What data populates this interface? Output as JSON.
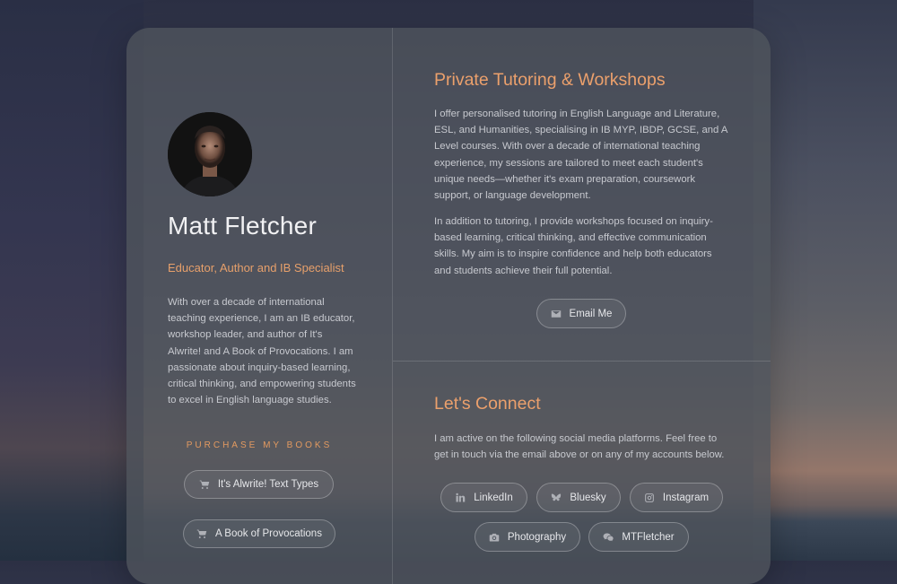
{
  "profile": {
    "name": "Matt Fletcher",
    "subtitle": "Educator, Author and IB Specialist",
    "bio": "With over a decade of international teaching experience, I am an IB educator, workshop leader, and author of It's Alwrite! and A Book of Provocations. I am passionate about inquiry-based learning, critical thinking, and empowering students to excel in English language studies."
  },
  "books": {
    "title": "PURCHASE MY BOOKS",
    "items": [
      {
        "label": "It's Alwrite! Text Types",
        "icon": "cart-icon"
      },
      {
        "label": "A Book of Provocations",
        "icon": "cart-icon"
      }
    ]
  },
  "tutoring": {
    "title": "Private Tutoring & Workshops",
    "para1": "I offer personalised tutoring in English Language and Literature, ESL, and Humanities, specialising in IB MYP, IBDP, GCSE, and A Level courses. With over a decade of international teaching experience, my sessions are tailored to meet each student's unique needs—whether it's exam preparation, coursework support, or language development.",
    "para2": "In addition to tutoring, I provide workshops focused on inquiry-based learning, critical thinking, and effective communication skills. My aim is to inspire confidence and help both educators and students achieve their full potential.",
    "email_label": "Email Me"
  },
  "connect": {
    "title": "Let's Connect",
    "para": "I am active on the following social media platforms. Feel free to get in touch via the email above or on any of my accounts below.",
    "links": [
      {
        "label": "LinkedIn",
        "icon": "linkedin-icon"
      },
      {
        "label": "Bluesky",
        "icon": "butterfly-icon"
      },
      {
        "label": "Instagram",
        "icon": "instagram-icon"
      },
      {
        "label": "Photography",
        "icon": "camera-icon"
      },
      {
        "label": "MTFletcher",
        "icon": "wechat-icon"
      }
    ]
  },
  "colors": {
    "accent": "#e9a06b",
    "text": "#c7c9cf",
    "card": "#50545c"
  }
}
